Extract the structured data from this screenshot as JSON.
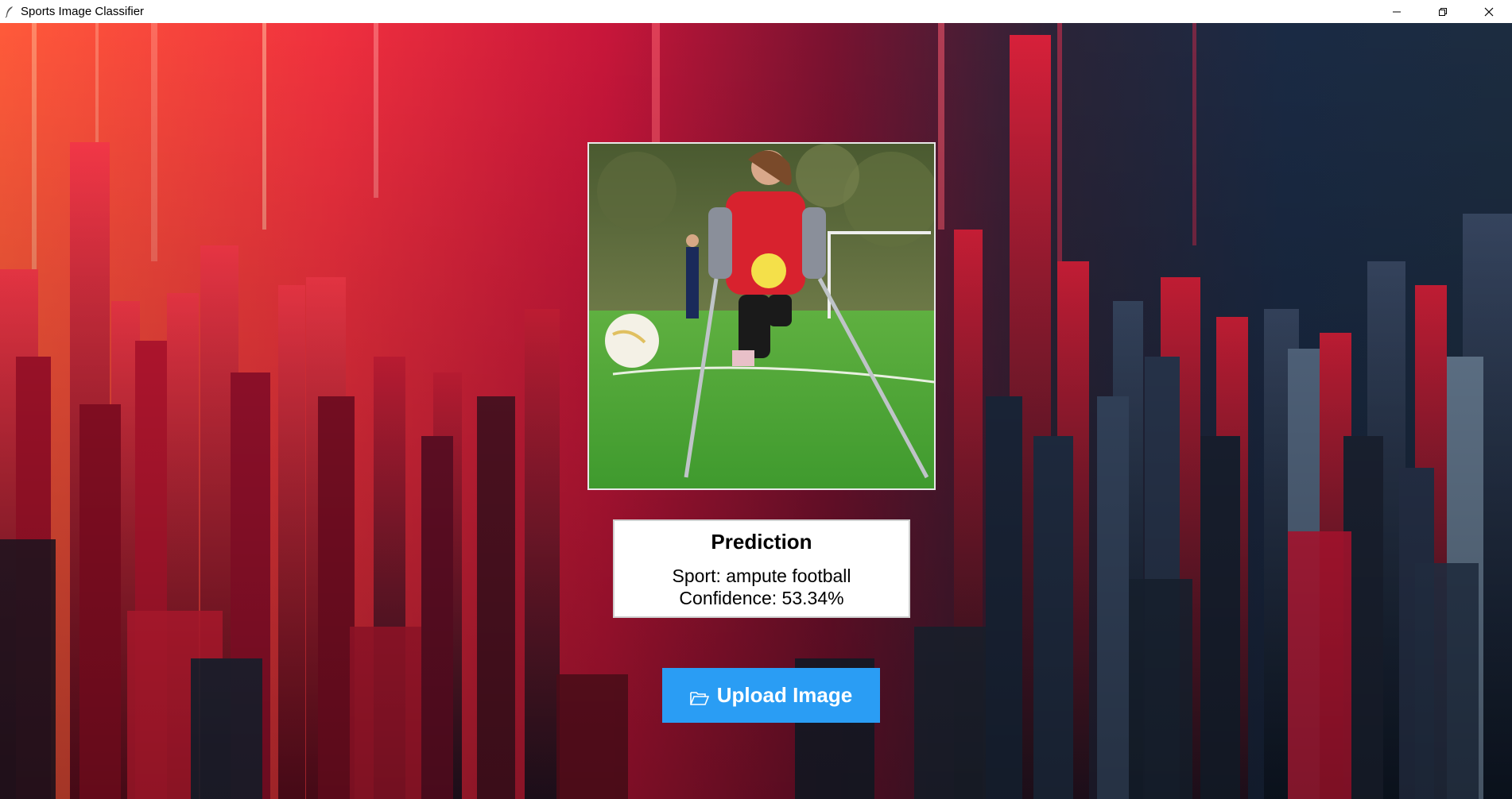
{
  "window": {
    "title": "Sports Image Classifier",
    "app_icon": "feather-icon",
    "controls": [
      "minimize-icon",
      "restore-icon",
      "close-icon"
    ]
  },
  "image": {
    "icon": "uploaded-photo"
  },
  "prediction": {
    "title": "Prediction",
    "sport": "Sport: ampute football",
    "confidence": "Confidence: 53.34%"
  },
  "upload_button": {
    "label": "Upload Image",
    "icon": "folder-open-icon",
    "color": "#2a9df4"
  },
  "colors": {
    "accent": "#2a9df4",
    "bg_warm": "#f0303e",
    "bg_cool": "#1a2a44"
  }
}
